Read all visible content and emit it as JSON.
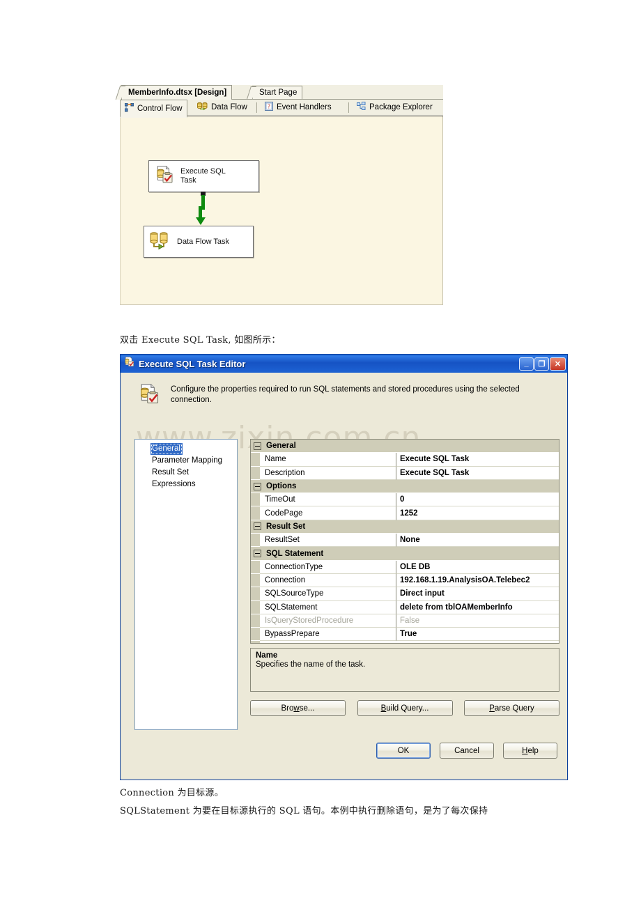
{
  "designer": {
    "document_tabs": [
      {
        "label": "MemberInfo.dtsx [Design]",
        "active": true
      },
      {
        "label": "Start Page",
        "active": false
      }
    ],
    "view_tabs": [
      {
        "label": "Control Flow",
        "icon": "control-flow-icon",
        "active": true
      },
      {
        "label": "Data Flow",
        "icon": "data-flow-icon",
        "active": false
      },
      {
        "label": "Event Handlers",
        "icon": "event-handlers-icon",
        "active": false
      },
      {
        "label": "Package Explorer",
        "icon": "package-explorer-icon",
        "active": false
      }
    ],
    "canvas": {
      "background": "#fbf6e2",
      "tasks": [
        {
          "id": "execute-sql-task",
          "label": "Execute SQL\nTask",
          "label_line1": "Execute SQL",
          "label_line2": "Task",
          "icon": "execute-sql-task-icon"
        },
        {
          "id": "data-flow-task",
          "label": "Data Flow Task",
          "icon": "data-flow-task-icon"
        }
      ],
      "connector": {
        "from": "execute-sql-task",
        "to": "data-flow-task",
        "color": "#0e8a0e",
        "type": "precedence-constraint-success"
      }
    }
  },
  "captions": {
    "above_dialog": "双击 Execute SQL Task, 如图所示：",
    "below_dialog_line1": "Connection 为目标源。",
    "below_dialog_line2": "SQLStatement 为要在目标源执行的 SQL 语句。本例中执行删除语句，是为了每次保持"
  },
  "dialog": {
    "title": "Execute SQL Task Editor",
    "title_icon": "execute-sql-task-icon",
    "window_buttons": {
      "minimize": "_",
      "maximize": "❐",
      "close": "✕"
    },
    "header": {
      "icon": "execute-sql-task-icon",
      "text": "Configure the properties required to run SQL statements and stored procedures using the selected connection."
    },
    "watermark": "www.zixin.com.cn",
    "nav": {
      "items": [
        {
          "label": "General",
          "selected": true
        },
        {
          "label": "Parameter Mapping",
          "selected": false
        },
        {
          "label": "Result Set",
          "selected": false
        },
        {
          "label": "Expressions",
          "selected": false
        }
      ]
    },
    "property_grid": {
      "rows": [
        {
          "kind": "category",
          "name": "General"
        },
        {
          "kind": "property",
          "name": "Name",
          "value": "Execute SQL Task",
          "readonly": false
        },
        {
          "kind": "property",
          "name": "Description",
          "value": "Execute SQL Task",
          "readonly": false
        },
        {
          "kind": "category",
          "name": "Options"
        },
        {
          "kind": "property",
          "name": "TimeOut",
          "value": "0",
          "readonly": false
        },
        {
          "kind": "property",
          "name": "CodePage",
          "value": "1252",
          "readonly": false
        },
        {
          "kind": "category",
          "name": "Result Set"
        },
        {
          "kind": "property",
          "name": "ResultSet",
          "value": "None",
          "readonly": false
        },
        {
          "kind": "category",
          "name": "SQL Statement"
        },
        {
          "kind": "property",
          "name": "ConnectionType",
          "value": "OLE DB",
          "readonly": false
        },
        {
          "kind": "property",
          "name": "Connection",
          "value": "192.168.1.19.AnalysisOA.Telebec2",
          "readonly": false
        },
        {
          "kind": "property",
          "name": "SQLSourceType",
          "value": "Direct input",
          "readonly": false
        },
        {
          "kind": "property",
          "name": "SQLStatement",
          "value": "delete from tblOAMemberInfo",
          "readonly": false
        },
        {
          "kind": "property",
          "name": "IsQueryStoredProcedure",
          "value": "False",
          "readonly": true
        },
        {
          "kind": "property",
          "name": "BypassPrepare",
          "value": "True",
          "readonly": false
        }
      ]
    },
    "description_pane": {
      "title": "Name",
      "body": "Specifies the name of the task."
    },
    "action_buttons": [
      {
        "label": "Browse...",
        "accel_index": 3,
        "name": "browse-button"
      },
      {
        "label": "Build Query...",
        "accel_index": 0,
        "name": "build-query-button"
      },
      {
        "label": "Parse Query",
        "accel_index": 0,
        "name": "parse-query-button"
      }
    ],
    "dialog_buttons": [
      {
        "label": "OK",
        "default": true,
        "name": "ok-button"
      },
      {
        "label": "Cancel",
        "default": false,
        "name": "cancel-button"
      },
      {
        "label": "Help",
        "accel_index": 0,
        "default": false,
        "name": "help-button"
      }
    ]
  }
}
